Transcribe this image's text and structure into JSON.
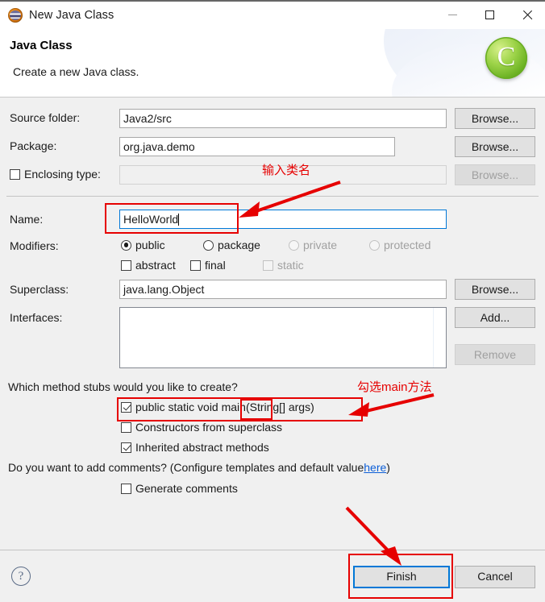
{
  "window": {
    "title": "New Java Class",
    "icon": "eclipse-java-icon",
    "minimize_label": "Minimize",
    "maximize_label": "Maximize",
    "close_label": "Close"
  },
  "header": {
    "title": "Java Class",
    "subtitle": "Create a new Java class.",
    "logo": "C"
  },
  "form": {
    "source_folder": {
      "label": "Source folder:",
      "value": "Java2/src",
      "browse_label": "Browse..."
    },
    "package": {
      "label": "Package:",
      "value": "org.java.demo",
      "browse_label": "Browse..."
    },
    "enclosing_type": {
      "label": "Enclosing type:",
      "value": "",
      "browse_label": "Browse...",
      "checked": false,
      "enabled": false
    },
    "name": {
      "label": "Name:",
      "value": "HelloWorld",
      "focused": true
    },
    "modifiers": {
      "label": "Modifiers:",
      "radios": [
        {
          "label": "public",
          "checked": true,
          "enabled": true
        },
        {
          "label": "package",
          "checked": false,
          "enabled": true
        },
        {
          "label": "private",
          "checked": false,
          "enabled": false
        },
        {
          "label": "protected",
          "checked": false,
          "enabled": false
        }
      ],
      "checkboxes": [
        {
          "label": "abstract",
          "checked": false,
          "enabled": true
        },
        {
          "label": "final",
          "checked": false,
          "enabled": true
        },
        {
          "label": "static",
          "checked": false,
          "enabled": false
        }
      ]
    },
    "superclass": {
      "label": "Superclass:",
      "value": "java.lang.Object",
      "browse_label": "Browse..."
    },
    "interfaces": {
      "label": "Interfaces:",
      "items": [],
      "add_label": "Add...",
      "remove_label": "Remove",
      "remove_enabled": false
    },
    "stubs": {
      "question": "Which method stubs would you like to create?",
      "options": [
        {
          "label": "public static void main(String[] args)",
          "checked": true
        },
        {
          "label": "Constructors from superclass",
          "checked": false
        },
        {
          "label": "Inherited abstract methods",
          "checked": true
        }
      ]
    },
    "comments": {
      "question_prefix": "Do you want to add comments? (Configure templates and default value ",
      "link": "here",
      "question_suffix": ")",
      "generate": {
        "label": "Generate comments",
        "checked": false
      }
    }
  },
  "footer": {
    "help": "?",
    "finish_label": "Finish",
    "cancel_label": "Cancel"
  },
  "annotations": {
    "color": "#e60000",
    "name_hint": "输入类名",
    "main_hint": "勾选main方法"
  }
}
